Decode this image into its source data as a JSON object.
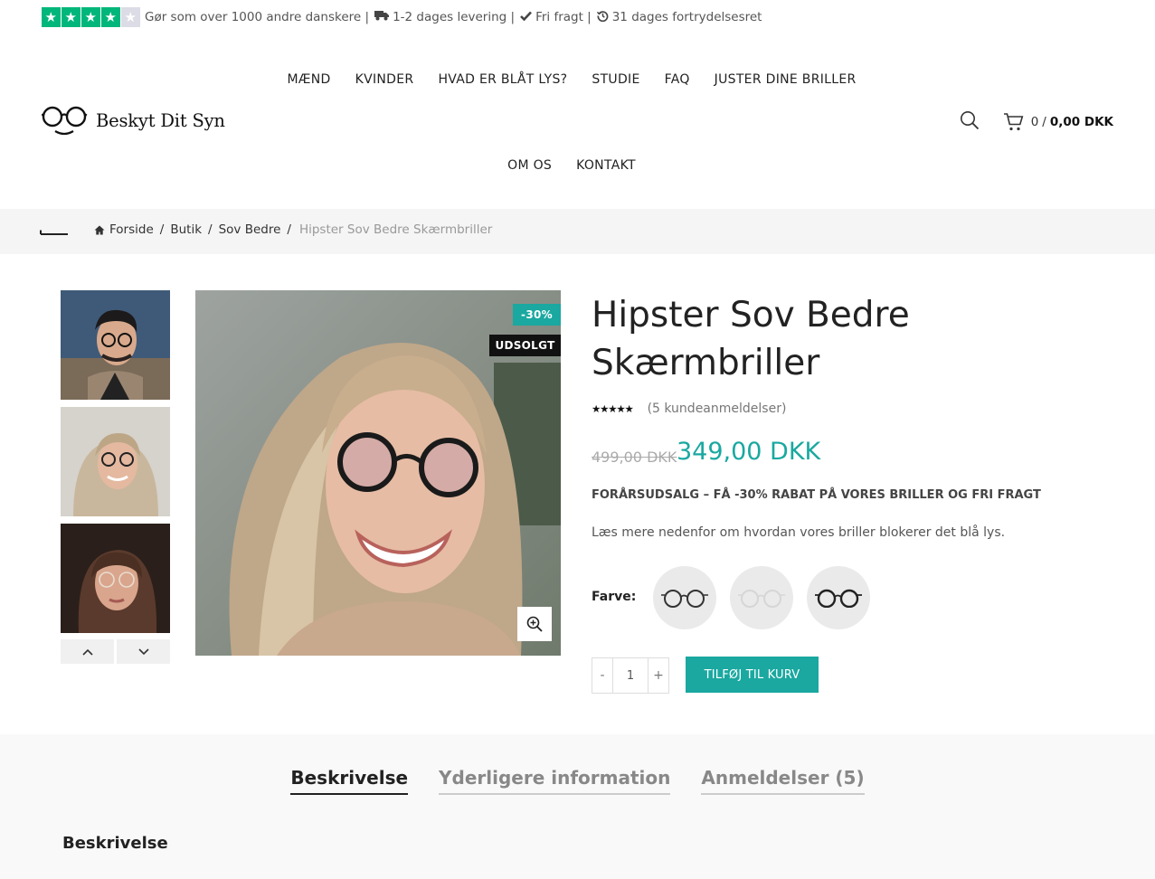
{
  "topbar": {
    "rating_stars_filled": 4,
    "rating_stars_total": 5,
    "trust_text": "Gør som over 1000 andre danskere |",
    "delivery_text": "1-2 dages levering |",
    "shipping_text": "Fri fragt |",
    "returns_text": "31 dages fortrydelsesret",
    "icons": [
      "truck-icon",
      "check-icon",
      "history-icon"
    ]
  },
  "logo": {
    "text": "Beskyt Dit Syn",
    "icon": "glasses-icon"
  },
  "nav": [
    "MÆND",
    "KVINDER",
    "HVAD ER BLÅT LYS?",
    "STUDIE",
    "FAQ",
    "JUSTER DINE BRILLER",
    "OM OS",
    "KONTAKT"
  ],
  "header": {
    "cart_count": "0",
    "cart_separator": "/",
    "cart_total": "0,00 DKK",
    "icons": [
      "search-icon",
      "cart-icon"
    ]
  },
  "breadcrumb": {
    "home": "Forside",
    "separator": "/",
    "items": [
      "Butik",
      "Sov Bedre"
    ],
    "current": "Hipster Sov Bedre Skærmbriller"
  },
  "gallery": {
    "badge_sale": "-30%",
    "badge_sold": "UDSOLGT",
    "thumbnails": [
      "man-with-glasses",
      "woman-blonde-glasses",
      "woman-clear-glasses"
    ]
  },
  "product": {
    "title": "Hipster Sov Bedre Skærmbriller",
    "rating": 5,
    "reviews_text": "(5 kundeanmeldelser)",
    "price_old": "499,00 DKK",
    "price_new": "349,00 DKK",
    "promo": "FORÅRSUDSALG – FÅ -30% RABAT PÅ VORES BRILLER OG FRI FRAGT",
    "description": "Læs mere nedenfor om hvordan vores briller blokerer det blå lys.",
    "swatch_label": "Farve",
    "swatch_label_suffix": ":",
    "swatches": [
      "black-frame",
      "clear-frame",
      "dark-frame"
    ],
    "qty_minus": "-",
    "qty_value": "1",
    "qty_plus": "+",
    "add_to_cart": "TILFØJ TIL KURV"
  },
  "tabs": {
    "items": [
      "Beskrivelse",
      "Yderligere information",
      "Anmeldelser (5)"
    ],
    "active": 0,
    "section_heading": "Beskrivelse"
  },
  "colors": {
    "accent": "#1aa8a0",
    "trustpilot_green": "#00b67a",
    "sold_badge": "#111111"
  }
}
